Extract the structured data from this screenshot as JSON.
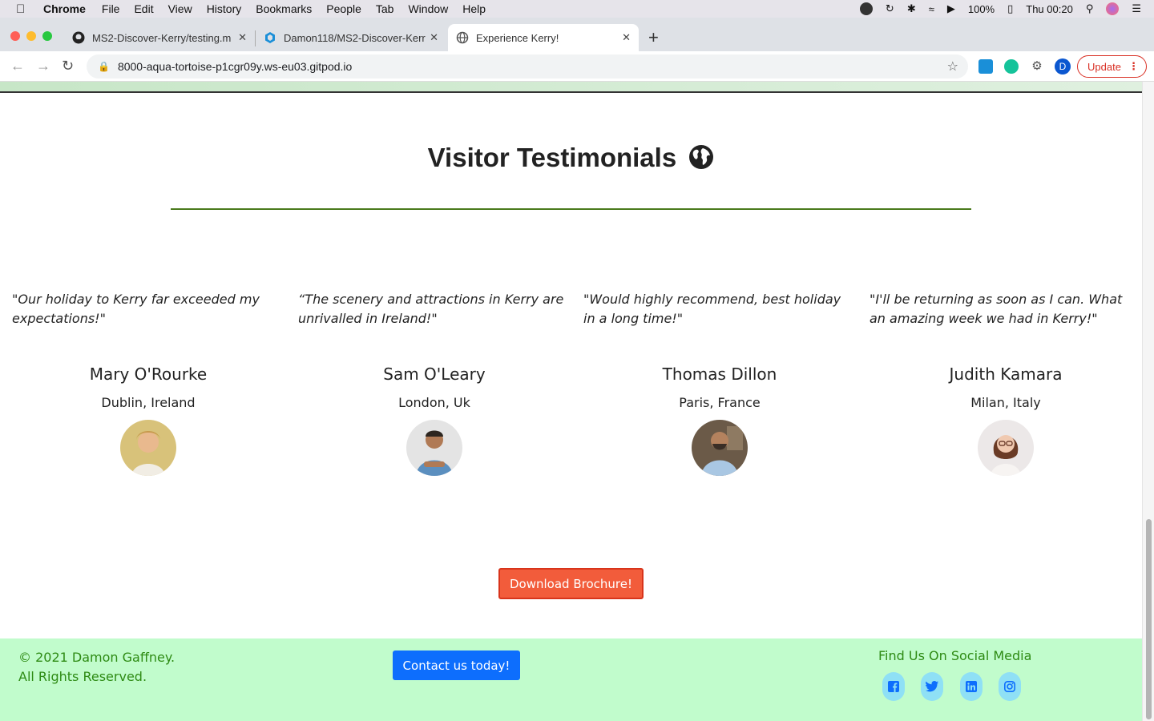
{
  "menubar": {
    "items": [
      "Chrome",
      "File",
      "Edit",
      "View",
      "History",
      "Bookmarks",
      "People",
      "Tab",
      "Window",
      "Help"
    ],
    "battery": "100%",
    "clock": "Thu 00:20"
  },
  "tabs": [
    {
      "title": "MS2-Discover-Kerry/testing.m",
      "icon": "github-icon"
    },
    {
      "title": "Damon118/MS2-Discover-Kerr",
      "icon": "gitpod-icon"
    },
    {
      "title": "Experience Kerry!",
      "icon": "globe-icon"
    }
  ],
  "toolbar": {
    "url": "8000-aqua-tortoise-p1cgr09y.ws-eu03.gitpod.io",
    "profile_initial": "D",
    "update_label": "Update"
  },
  "page": {
    "heading": "Visitor Testimonials",
    "testimonials": [
      {
        "quote": "\"Our holiday to Kerry far exceeded my expectations!\"",
        "name": "Mary O'Rourke",
        "location": "Dublin, Ireland"
      },
      {
        "quote": "“The scenery and attractions in Kerry are unrivalled in Ireland!\"",
        "name": "Sam O'Leary",
        "location": "London, Uk"
      },
      {
        "quote": "\"Would highly recommend, best holiday in a long time!\"",
        "name": "Thomas Dillon",
        "location": "Paris, France"
      },
      {
        "quote": "\"I'll be returning as soon as I can. What an amazing week we had in Kerry!\"",
        "name": "Judith Kamara",
        "location": "Milan, Italy"
      }
    ],
    "brochure_label": "Download Brochure!"
  },
  "footer": {
    "copyright_line1": "© 2021 Damon Gaffney.",
    "copyright_line2": "All Rights Reserved.",
    "contact_label": "Contact us today!",
    "social_title": "Find Us On Social Media",
    "social_icons": [
      "facebook-icon",
      "twitter-icon",
      "linkedin-icon",
      "instagram-icon"
    ]
  },
  "colors": {
    "brochure": "#f25c3b",
    "contact": "#0d6efd",
    "footer_bg": "#c1fccc",
    "footer_text": "#2e8b14",
    "rule": "#4a7a1c"
  }
}
